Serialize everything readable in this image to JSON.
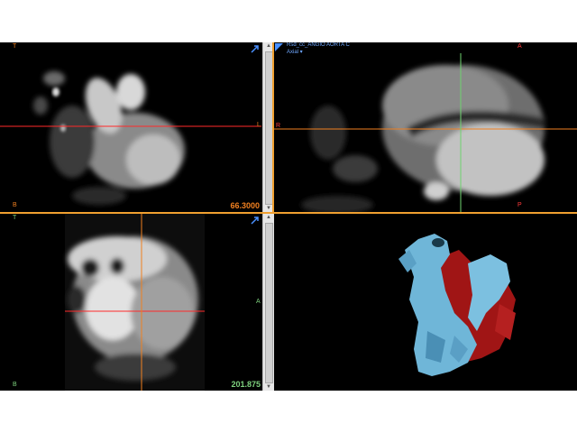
{
  "panes": {
    "top_left": {
      "orient_top": "T",
      "orient_bottom": "B",
      "orient_right": "L",
      "value": "66.3000"
    },
    "top_right": {
      "series_name": "Rsd_cc_ANGIO AORTA C",
      "view_mode": "Axial ▾",
      "orient_top": "A",
      "orient_left": "R",
      "orient_bottom": "P"
    },
    "bottom_left": {
      "orient_top": "T",
      "orient_bottom": "B",
      "orient_right": "A",
      "value": "201.875"
    },
    "bottom_right": {}
  },
  "colors": {
    "crosshair_red": "#ff2a2a",
    "crosshair_orange": "#f08020",
    "crosshair_green": "#6fd36f",
    "mesh_blue": "#6fb6d8",
    "mesh_red": "#b01818"
  },
  "icons": {
    "maximize": "corner-arrow-icon"
  }
}
